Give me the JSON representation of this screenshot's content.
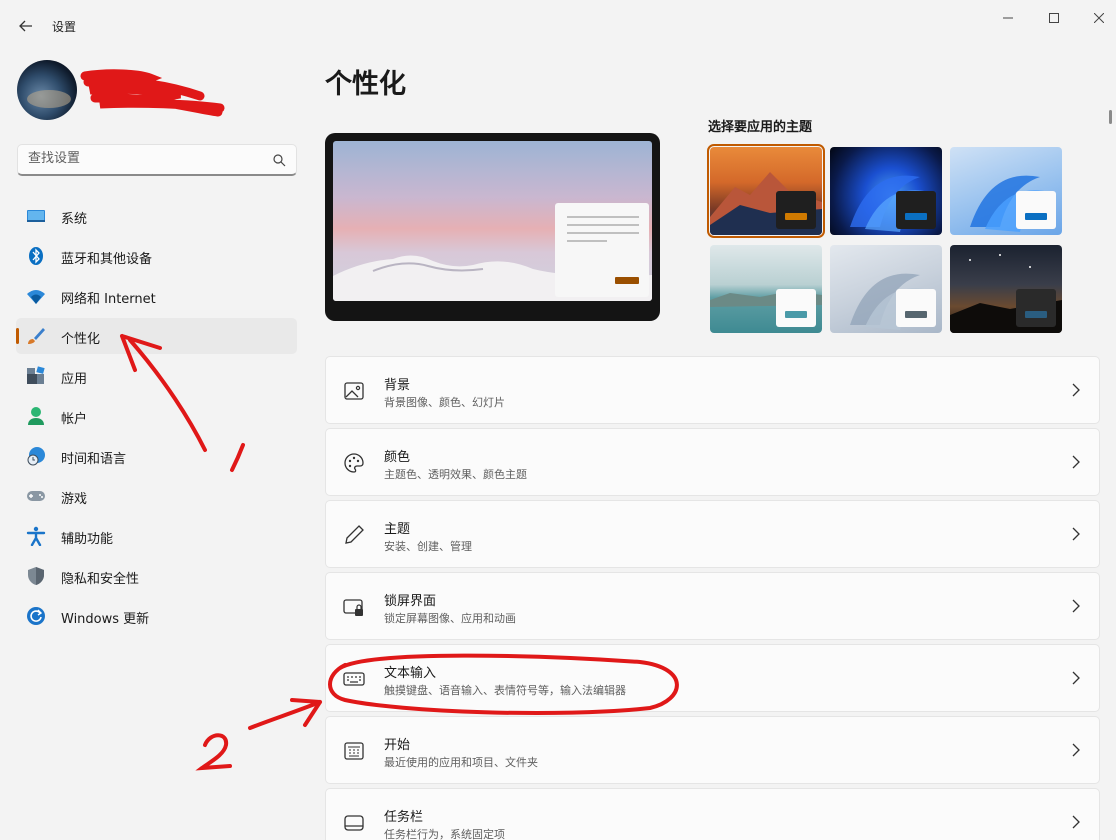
{
  "window": {
    "title": "设置",
    "back_icon": "arrow-left-icon",
    "controls": [
      "minimize-icon",
      "maximize-icon",
      "close-icon"
    ]
  },
  "search": {
    "placeholder": "查找设置",
    "icon": "search-icon"
  },
  "sidebar": {
    "items": [
      {
        "label": "系统",
        "icon": "monitor-icon",
        "active": false
      },
      {
        "label": "蓝牙和其他设备",
        "icon": "bluetooth-icon",
        "active": false
      },
      {
        "label": "网络和 Internet",
        "icon": "wifi-icon",
        "active": false
      },
      {
        "label": "个性化",
        "icon": "brush-icon",
        "active": true
      },
      {
        "label": "应用",
        "icon": "apps-icon",
        "active": false
      },
      {
        "label": "帐户",
        "icon": "person-icon",
        "active": false
      },
      {
        "label": "时间和语言",
        "icon": "globe-clock-icon",
        "active": false
      },
      {
        "label": "游戏",
        "icon": "gamepad-icon",
        "active": false
      },
      {
        "label": "辅助功能",
        "icon": "accessibility-icon",
        "active": false
      },
      {
        "label": "隐私和安全性",
        "icon": "shield-icon",
        "active": false
      },
      {
        "label": "Windows 更新",
        "icon": "refresh-icon",
        "active": false
      }
    ]
  },
  "main": {
    "page_title": "个性化",
    "themes_label": "选择要应用的主题",
    "themes": [
      {
        "name": "theme-1",
        "selected": true,
        "chip": "#1f1f1f",
        "accent": "#d07a00"
      },
      {
        "name": "theme-2",
        "selected": false,
        "chip": "#1f1f1f",
        "accent": "#0a6fc2"
      },
      {
        "name": "theme-3",
        "selected": false,
        "chip": "#fafafa",
        "accent": "#0a6fc2"
      },
      {
        "name": "theme-4",
        "selected": false,
        "chip": "#fafafa",
        "accent": "#4a9aa8"
      },
      {
        "name": "theme-5",
        "selected": false,
        "chip": "#fafafa",
        "accent": "#56666f"
      },
      {
        "name": "theme-6",
        "selected": false,
        "chip": "#2a2a2a",
        "accent": "#2a5d80"
      }
    ],
    "rows": [
      {
        "title": "背景",
        "desc": "背景图像、颜色、幻灯片",
        "icon": "image-icon"
      },
      {
        "title": "颜色",
        "desc": "主题色、透明效果、颜色主题",
        "icon": "palette-icon"
      },
      {
        "title": "主题",
        "desc": "安装、创建、管理",
        "icon": "pen-icon"
      },
      {
        "title": "锁屏界面",
        "desc": "锁定屏幕图像、应用和动画",
        "icon": "lock-screen-icon"
      },
      {
        "title": "文本输入",
        "desc": "触摸键盘、语音输入、表情符号等，输入法编辑器",
        "icon": "keyboard-icon"
      },
      {
        "title": "开始",
        "desc": "最近使用的应用和项目、文件夹",
        "icon": "start-icon"
      },
      {
        "title": "任务栏",
        "desc": "任务栏行为，系统固定项",
        "icon": "taskbar-icon"
      }
    ]
  },
  "colors": {
    "accent": "#c05a00",
    "annotation_red": "#e01818"
  }
}
